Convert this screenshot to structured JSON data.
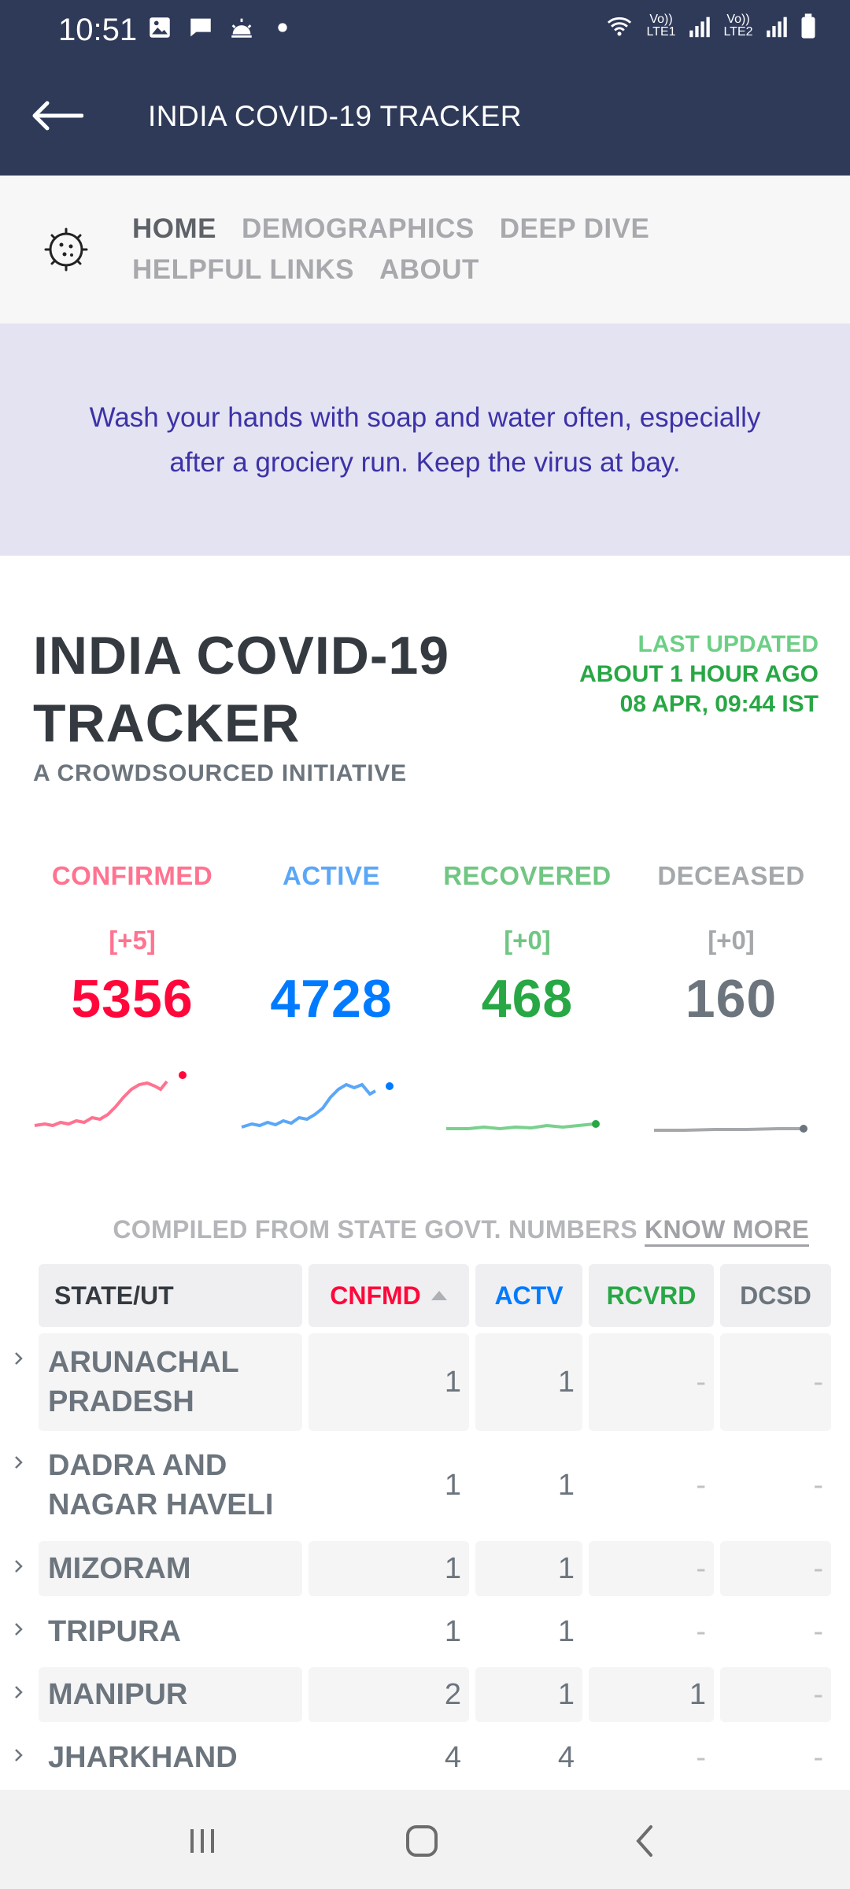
{
  "status_bar": {
    "time": "10:51",
    "sim1": "Vo)) LTE1",
    "sim2": "Vo)) LTE2"
  },
  "app_bar": {
    "title": "INDIA COVID-19 TRACKER"
  },
  "nav": {
    "links": [
      "HOME",
      "DEMOGRAPHICS",
      "DEEP DIVE",
      "HELPFUL LINKS",
      "ABOUT"
    ],
    "active": "HOME"
  },
  "banner": {
    "text": "Wash your hands with soap and water often, especially after a grociery run. Keep the virus at bay."
  },
  "header": {
    "title": "INDIA COVID-19 TRACKER",
    "subtitle": "A CROWDSOURCED INITIATIVE",
    "last_updated_label": "LAST UPDATED",
    "last_updated_relative": "ABOUT 1 HOUR AGO",
    "last_updated_time": "08 APR, 09:44 IST"
  },
  "levels": {
    "confirmed": {
      "label": "CONFIRMED",
      "delta": "[+5]",
      "value": "5356",
      "color": "#ff073a"
    },
    "active": {
      "label": "ACTIVE",
      "delta": "",
      "value": "4728",
      "color": "#007bff"
    },
    "recovered": {
      "label": "RECOVERED",
      "delta": "[+0]",
      "value": "468",
      "color": "#28a745"
    },
    "deceased": {
      "label": "DECEASED",
      "delta": "[+0]",
      "value": "160",
      "color": "#6c757d"
    }
  },
  "table": {
    "compiled_note": "COMPILED FROM STATE GOVT. NUMBERS",
    "know_more": "KNOW MORE",
    "headers": {
      "state": "STATE/UT",
      "confirmed": "CNFMD",
      "active": "ACTV",
      "recovered": "RCVRD",
      "deceased": "DCSD"
    },
    "rows": [
      {
        "state": "ARUNACHAL PRADESH",
        "confirmed": "1",
        "active": "1",
        "recovered": "-",
        "deceased": "-"
      },
      {
        "state": "DADRA AND NAGAR HAVELI",
        "confirmed": "1",
        "active": "1",
        "recovered": "-",
        "deceased": "-"
      },
      {
        "state": "MIZORAM",
        "confirmed": "1",
        "active": "1",
        "recovered": "-",
        "deceased": "-"
      },
      {
        "state": "TRIPURA",
        "confirmed": "1",
        "active": "1",
        "recovered": "-",
        "deceased": "-"
      },
      {
        "state": "MANIPUR",
        "confirmed": "2",
        "active": "1",
        "recovered": "1",
        "deceased": "-"
      },
      {
        "state": "JHARKHAND",
        "confirmed": "4",
        "active": "4",
        "recovered": "-",
        "deceased": "-"
      }
    ]
  },
  "bottom_nav": [
    "recent-apps",
    "home",
    "back"
  ]
}
